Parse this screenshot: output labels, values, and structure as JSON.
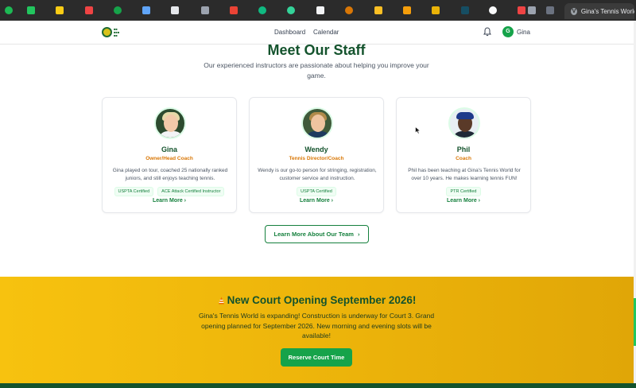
{
  "browser": {
    "active_tab_title": "Gina's Tennis World...",
    "active_tab_icon": "V",
    "pinned_tab_icons": [
      "spotify-icon",
      "k-app-icon",
      "yellow-app-icon",
      "youtube-icon",
      "map-pin-icon",
      "doc-icon",
      "notes-icon",
      "k-icon",
      "gmail-icon",
      "shield-icon",
      "maps-icon",
      "blank-icon",
      "coin-icon",
      "chart-icon",
      "image-icon",
      "stamp-icon",
      "dark-app-icon",
      "github-icon",
      "youtube-icon",
      "audio-icon",
      "p-icon"
    ]
  },
  "nav": {
    "links": [
      "Dashboard",
      "Calendar"
    ],
    "user_initial": "G",
    "user_name": "Gina"
  },
  "staff": {
    "title": "Meet Our Staff",
    "subtitle": "Our experienced instructors are passionate about helping you improve your game.",
    "members": [
      {
        "name": "Gina",
        "role": "Owner/Head Coach",
        "bio": "Gina played on tour, coached 25 nationally ranked juniors, and still enjoys teaching tennis.",
        "badges": [
          "USPTA Certified",
          "ACE Attack Certified Instructor"
        ],
        "link": "Learn More"
      },
      {
        "name": "Wendy",
        "role": "Tennis Director/Coach",
        "bio": "Wendy is our go-to person for stringing, registration, customer service and instruction.",
        "badges": [
          "USPTA Certified"
        ],
        "link": "Learn More"
      },
      {
        "name": "Phil",
        "role": "Coach",
        "bio": "Phil has been teaching at Gina's Tennis World for over 10 years. He makes learning tennis FUN!",
        "badges": [
          "PTR Certified"
        ],
        "link": "Learn More"
      }
    ],
    "team_button": "Learn More About Our Team"
  },
  "promo": {
    "title": "New Court Opening September 2026!",
    "text": "Gina's Tennis World is expanding! Construction is underway for Court 3. Grand opening planned for September 2026. New morning and evening slots will be available!",
    "button": "Reserve Court Time"
  },
  "colors": {
    "brand_green": "#14532d",
    "accent_green": "#16a34a",
    "role_orange": "#d97706",
    "promo_yellow": "#f7c20f"
  }
}
